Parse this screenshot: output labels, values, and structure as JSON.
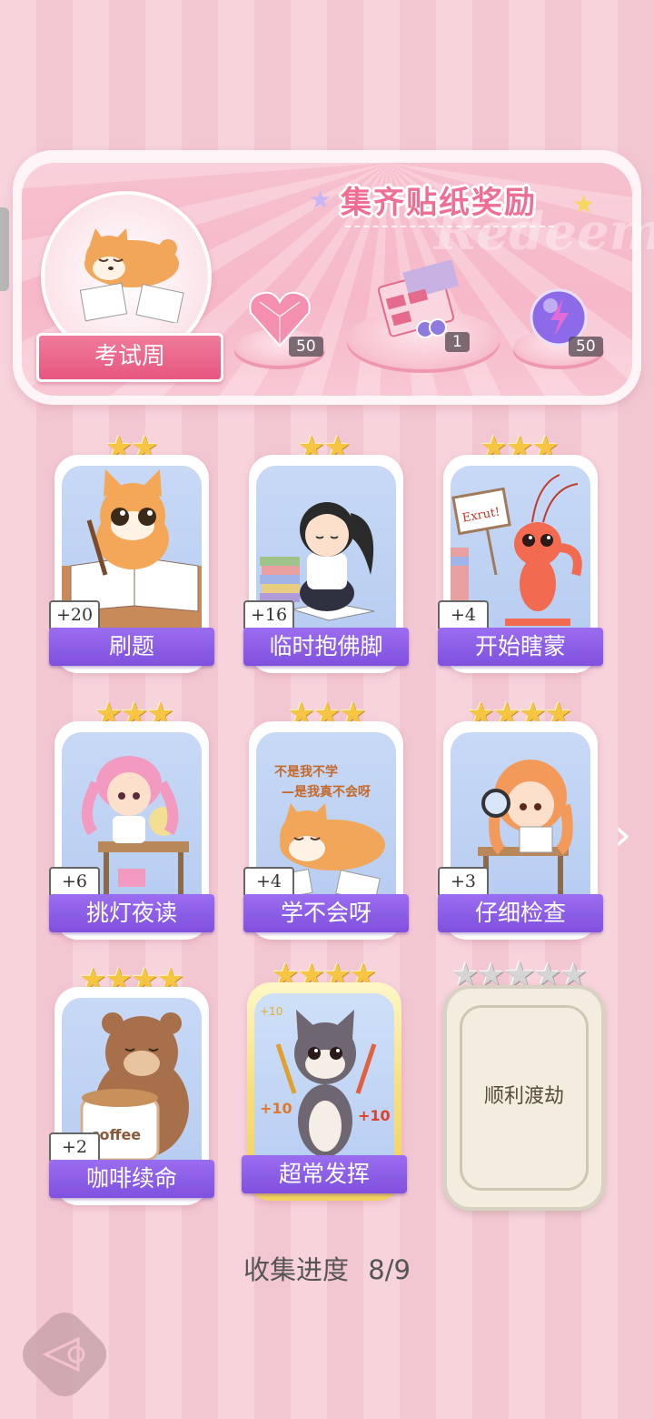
{
  "banner": {
    "title": "集齐贴纸奖励",
    "watermark": "Redeem",
    "character_label": "考试周",
    "rewards": [
      {
        "name": "pink-heart-gem",
        "count": "50"
      },
      {
        "name": "sticker-box",
        "count": "1"
      },
      {
        "name": "purple-energy-orb",
        "count": "50"
      }
    ]
  },
  "cards": [
    {
      "label": "刷题",
      "points": "+20",
      "stars": 2
    },
    {
      "label": "临时抱佛脚",
      "points": "+16",
      "stars": 2
    },
    {
      "label": "开始瞎蒙",
      "points": "+4",
      "stars": 3
    },
    {
      "label": "挑灯夜读",
      "points": "+6",
      "stars": 3
    },
    {
      "label": "学不会呀",
      "points": "+4",
      "stars": 3
    },
    {
      "label": "仔细检查",
      "points": "+3",
      "stars": 4
    },
    {
      "label": "咖啡续命",
      "points": "+2",
      "stars": 4
    },
    {
      "label": "超常发挥",
      "points": "",
      "stars": 4
    },
    {
      "label": "顺利渡劫",
      "points": "",
      "stars": 5,
      "locked": true
    }
  ],
  "card_art_text": {
    "lobster_sign": "Exrut!",
    "shiba_text_1": "不是我不学",
    "shiba_text_2": "—是我真不会呀",
    "coffee_cup": "coffee",
    "gold_plus_1": "+10",
    "gold_plus_2": "+10",
    "gold_plus_3": "+10"
  },
  "progress": {
    "label": "收集进度",
    "value": "8/9"
  },
  "colors": {
    "ribbon": "#8a5ce6",
    "title": "#ef6f94",
    "star": "#f6c542"
  }
}
